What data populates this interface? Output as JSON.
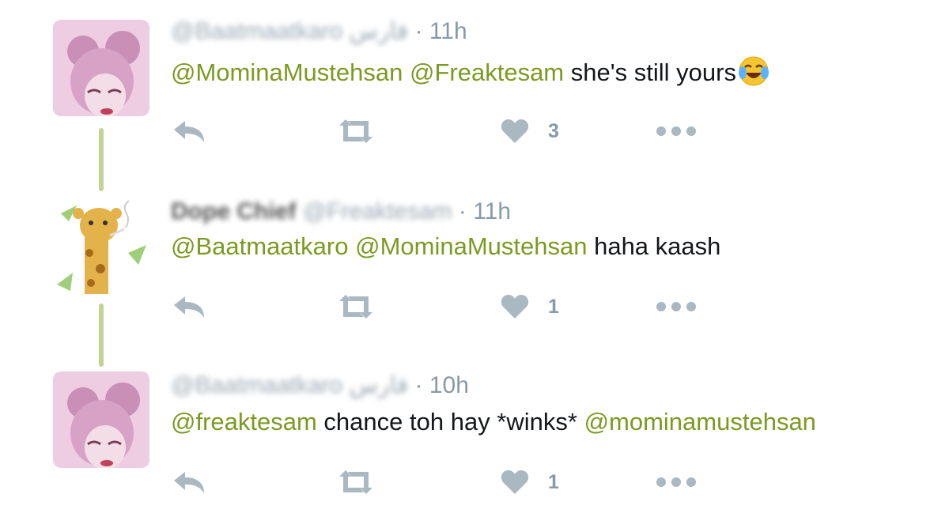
{
  "colors": {
    "mention": "#7b9a22",
    "icon": "#aab8c2",
    "thread_line": "#c2d495"
  },
  "tweets": [
    {
      "handle_blurred": "@Baatmaatkaro فارس",
      "display_name_blurred": "",
      "time": "· 11h",
      "segments": [
        {
          "type": "mention",
          "text": "@MominaMustehsan"
        },
        {
          "type": "plain",
          "text": " "
        },
        {
          "type": "mention",
          "text": "@Freaktesam"
        },
        {
          "type": "plain",
          "text": " she's still yours"
        }
      ],
      "emoji": "face-with-tears-of-joy-icon",
      "likes": "3",
      "avatar": "pink-hair-avatar"
    },
    {
      "handle_blurred": "@Freaktesam",
      "display_name_blurred": "Dope Chief",
      "time": "· 11h",
      "segments": [
        {
          "type": "mention",
          "text": "@Baatmaatkaro"
        },
        {
          "type": "plain",
          "text": " "
        },
        {
          "type": "mention",
          "text": "@MominaMustehsan"
        },
        {
          "type": "plain",
          "text": " haha kaash"
        }
      ],
      "likes": "1",
      "avatar": "giraffe-avatar"
    },
    {
      "handle_blurred": "@Baatmaatkaro فارس",
      "display_name_blurred": "",
      "time": "· 10h",
      "segments": [
        {
          "type": "mention",
          "text": "@freaktesam"
        },
        {
          "type": "plain",
          "text": " chance toh hay *winks* "
        },
        {
          "type": "mention",
          "text": "@mominamustehsan"
        }
      ],
      "likes": "1",
      "avatar": "pink-hair-avatar"
    }
  ]
}
